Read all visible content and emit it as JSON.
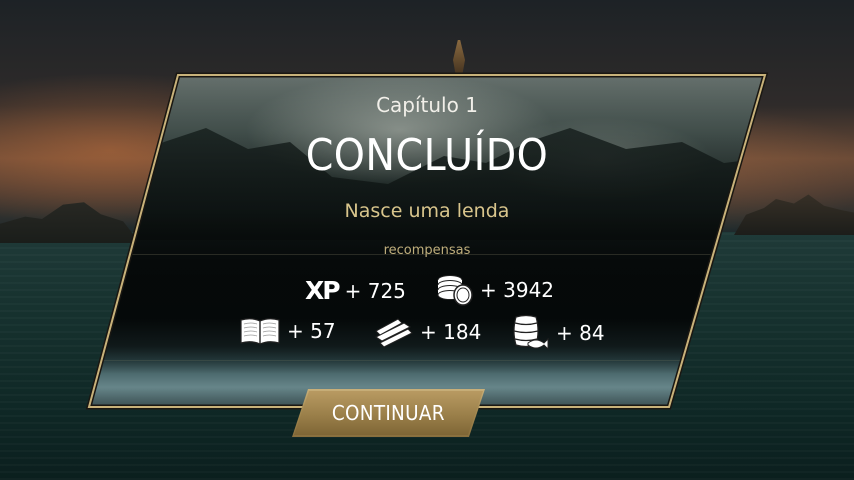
{
  "dialog": {
    "chapter": "Capítulo 1",
    "status": "CONCLUÍDO",
    "subtitle": "Nasce uma lenda",
    "rewards_label": "recompensas"
  },
  "rewards": [
    {
      "icon": "xp-icon",
      "label": "XP",
      "value": "+ 725"
    },
    {
      "icon": "coins-icon",
      "value": "+ 3942"
    },
    {
      "icon": "book-icon",
      "value": "+ 57"
    },
    {
      "icon": "planks-icon",
      "value": "+ 184"
    },
    {
      "icon": "barrel-fish-icon",
      "value": "+ 84"
    }
  ],
  "actions": {
    "continue_label": "CONTINUAR"
  },
  "colors": {
    "accent_gold": "#d8c58c",
    "border_gold": "#c8b27a",
    "button_gold": "#a58a52"
  }
}
